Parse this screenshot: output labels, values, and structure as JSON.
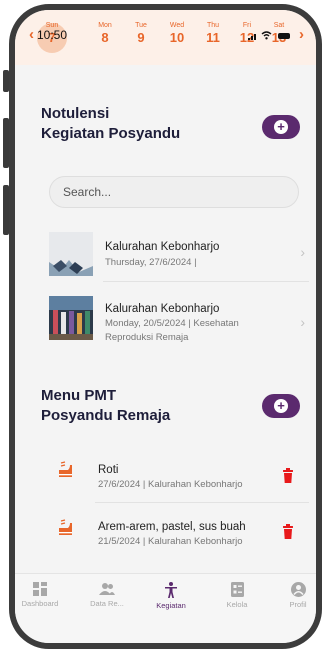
{
  "status": {
    "time": "10:50"
  },
  "calendar": {
    "prev_arrow": "‹",
    "next_arrow": "›",
    "days": [
      {
        "name": "Sun",
        "date": "7"
      },
      {
        "name": "Mon",
        "date": "8"
      },
      {
        "name": "Tue",
        "date": "9"
      },
      {
        "name": "Wed",
        "date": "10"
      },
      {
        "name": "Thu",
        "date": "11"
      },
      {
        "name": "Fri",
        "date": "12"
      },
      {
        "name": "Sat",
        "date": "13"
      }
    ],
    "colors": {
      "accent": "#e8662a",
      "bar_bg": "#fdf0e8",
      "today_circle": "#f6c6a8"
    }
  },
  "notulensi": {
    "title_line1": "Notulensi",
    "title_line2": "Kegiatan Posyandu",
    "add_label": "+",
    "search_placeholder": "Search...",
    "items": [
      {
        "title": "Kalurahan Kebonharjo",
        "subtitle": "Thursday, 27/6/2024 |"
      },
      {
        "title": "Kalurahan Kebonharjo",
        "subtitle": "Monday, 20/5/2024 | Kesehatan Reproduksi Remaja"
      }
    ]
  },
  "pmt": {
    "title_line1": "Menu PMT",
    "title_line2": "Posyandu Remaja",
    "add_label": "+",
    "items": [
      {
        "title": "Roti",
        "subtitle": "27/6/2024 | Kalurahan Kebonharjo"
      },
      {
        "title": "Arem-arem, pastel, sus buah",
        "subtitle": "21/5/2024 | Kalurahan Kebonharjo"
      }
    ]
  },
  "nav": {
    "items": [
      {
        "label": "Dashboard",
        "icon": "dashboard-icon"
      },
      {
        "label": "Data Re...",
        "icon": "users-icon"
      },
      {
        "label": "Kegiatan",
        "icon": "person-activity-icon",
        "active": true
      },
      {
        "label": "Kelola",
        "icon": "manage-icon"
      },
      {
        "label": "Profil",
        "icon": "profile-icon"
      }
    ]
  },
  "colors": {
    "primary": "#5b2a6e",
    "delete": "#e8191b",
    "title_text": "#1e1e3a"
  }
}
